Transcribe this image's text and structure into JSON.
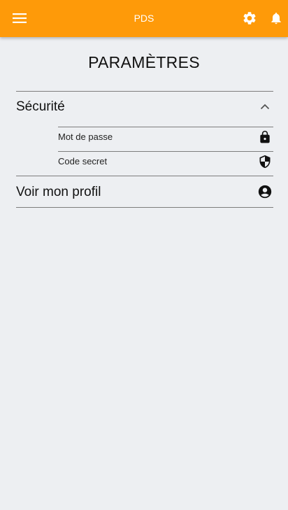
{
  "app_bar": {
    "title": "PDS",
    "background": "#fe9a09",
    "icons": [
      "menu-icon",
      "gear-icon",
      "bell-icon"
    ]
  },
  "page": {
    "title": "PARAMÈTRES"
  },
  "settings": {
    "security": {
      "label": "Sécurité",
      "expanded": true,
      "icon": "chevron-up-icon",
      "items": [
        {
          "label": "Mot de passe",
          "icon": "lock-icon"
        },
        {
          "label": "Code secret",
          "icon": "shield-icon"
        }
      ]
    },
    "profile": {
      "label": "Voir mon profil",
      "icon": "account-circle-icon"
    }
  }
}
